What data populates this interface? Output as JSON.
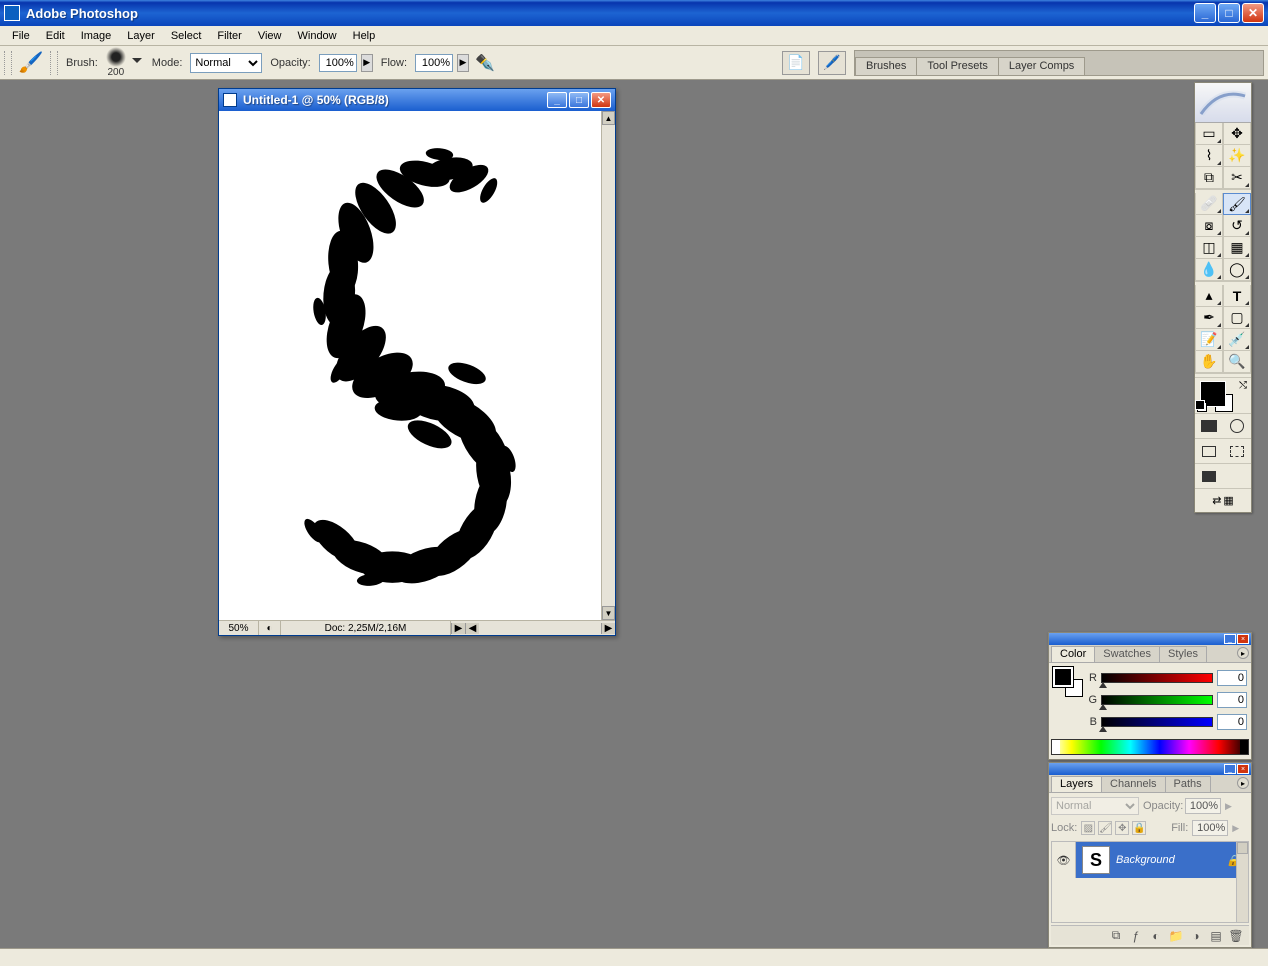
{
  "app": {
    "title": "Adobe Photoshop"
  },
  "menu": [
    "File",
    "Edit",
    "Image",
    "Layer",
    "Select",
    "Filter",
    "View",
    "Window",
    "Help"
  ],
  "options": {
    "brush_label": "Brush:",
    "brush_size": "200",
    "mode_label": "Mode:",
    "mode_value": "Normal",
    "opacity_label": "Opacity:",
    "opacity_value": "100%",
    "flow_label": "Flow:",
    "flow_value": "100%"
  },
  "palettes_well": [
    "Brushes",
    "Tool Presets",
    "Layer Comps"
  ],
  "document": {
    "title": "Untitled-1 @ 50% (RGB/8)",
    "zoom": "50%",
    "info": "Doc: 2,25M/2,16M"
  },
  "color_panel": {
    "tabs": [
      "Color",
      "Swatches",
      "Styles"
    ],
    "r_label": "R",
    "r_value": "0",
    "g_label": "G",
    "g_value": "0",
    "b_label": "B",
    "b_value": "0"
  },
  "layers_panel": {
    "tabs": [
      "Layers",
      "Channels",
      "Paths"
    ],
    "blend_mode": "Normal",
    "opacity_label": "Opacity:",
    "opacity_value": "100%",
    "lock_label": "Lock:",
    "fill_label": "Fill:",
    "fill_value": "100%",
    "layer_name": "Background"
  }
}
